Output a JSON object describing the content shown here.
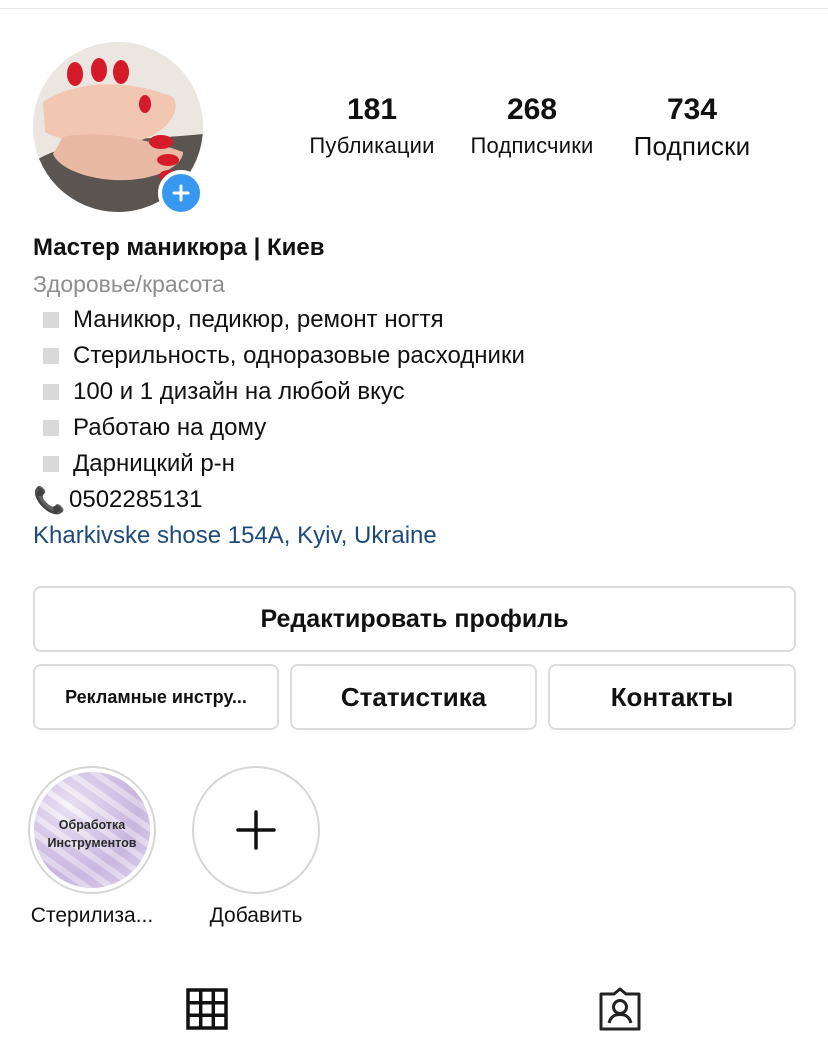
{
  "profile": {
    "name": "Мастер маникюра | Киев",
    "category": "Здоровье/красота"
  },
  "stats": {
    "posts": {
      "value": "181",
      "label": "Публикации"
    },
    "followers": {
      "value": "268",
      "label": "Подписчики"
    },
    "following": {
      "value": "734",
      "label": "Подписки"
    }
  },
  "bio": {
    "lines": [
      "Маникюр, педикюр, ремонт ногтя",
      "Стерильность, одноразовые расходники",
      "100 и 1 дизайн на любой вкус",
      "Работаю на дому",
      "Дарницкий р-н"
    ],
    "phone": "0502285131",
    "address": "Kharkivske shose 154A, Kyiv, Ukraine"
  },
  "buttons": {
    "edit_profile": "Редактировать профиль",
    "promo_tools": "Рекламные инстру...",
    "statistics": "Статистика",
    "contacts": "Контакты"
  },
  "highlights": [
    {
      "label": "Стерилиза...",
      "cover_text_1": "Обработка",
      "cover_text_2": "Инструментов"
    },
    {
      "label": "Добавить"
    }
  ],
  "icons": {
    "avatar_add": "plus-circle-icon",
    "bullet": "gray-square-icon",
    "phone": "telephone-icon",
    "highlight_add": "plus-icon",
    "tab_grid": "grid-icon",
    "tab_tagged": "tagged-person-icon"
  },
  "colors": {
    "accent_blue": "#3897f0",
    "link": "#1e4a7a",
    "muted": "#8e8e8e",
    "border": "#dcdcdc"
  }
}
